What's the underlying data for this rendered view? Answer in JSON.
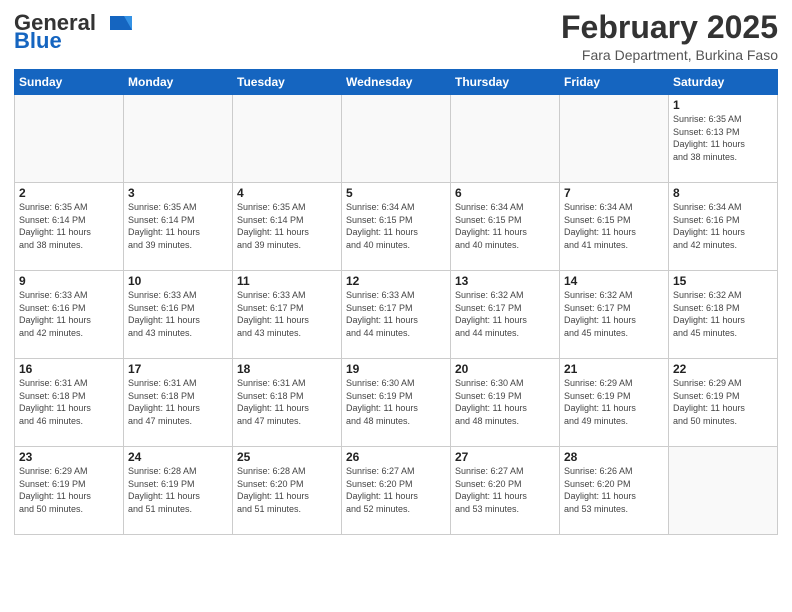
{
  "header": {
    "logo_general": "General",
    "logo_blue": "Blue",
    "month_year": "February 2025",
    "location": "Fara Department, Burkina Faso"
  },
  "days_of_week": [
    "Sunday",
    "Monday",
    "Tuesday",
    "Wednesday",
    "Thursday",
    "Friday",
    "Saturday"
  ],
  "weeks": [
    [
      {
        "day": "",
        "info": ""
      },
      {
        "day": "",
        "info": ""
      },
      {
        "day": "",
        "info": ""
      },
      {
        "day": "",
        "info": ""
      },
      {
        "day": "",
        "info": ""
      },
      {
        "day": "",
        "info": ""
      },
      {
        "day": "1",
        "info": "Sunrise: 6:35 AM\nSunset: 6:13 PM\nDaylight: 11 hours\nand 38 minutes."
      }
    ],
    [
      {
        "day": "2",
        "info": "Sunrise: 6:35 AM\nSunset: 6:14 PM\nDaylight: 11 hours\nand 38 minutes."
      },
      {
        "day": "3",
        "info": "Sunrise: 6:35 AM\nSunset: 6:14 PM\nDaylight: 11 hours\nand 39 minutes."
      },
      {
        "day": "4",
        "info": "Sunrise: 6:35 AM\nSunset: 6:14 PM\nDaylight: 11 hours\nand 39 minutes."
      },
      {
        "day": "5",
        "info": "Sunrise: 6:34 AM\nSunset: 6:15 PM\nDaylight: 11 hours\nand 40 minutes."
      },
      {
        "day": "6",
        "info": "Sunrise: 6:34 AM\nSunset: 6:15 PM\nDaylight: 11 hours\nand 40 minutes."
      },
      {
        "day": "7",
        "info": "Sunrise: 6:34 AM\nSunset: 6:15 PM\nDaylight: 11 hours\nand 41 minutes."
      },
      {
        "day": "8",
        "info": "Sunrise: 6:34 AM\nSunset: 6:16 PM\nDaylight: 11 hours\nand 42 minutes."
      }
    ],
    [
      {
        "day": "9",
        "info": "Sunrise: 6:33 AM\nSunset: 6:16 PM\nDaylight: 11 hours\nand 42 minutes."
      },
      {
        "day": "10",
        "info": "Sunrise: 6:33 AM\nSunset: 6:16 PM\nDaylight: 11 hours\nand 43 minutes."
      },
      {
        "day": "11",
        "info": "Sunrise: 6:33 AM\nSunset: 6:17 PM\nDaylight: 11 hours\nand 43 minutes."
      },
      {
        "day": "12",
        "info": "Sunrise: 6:33 AM\nSunset: 6:17 PM\nDaylight: 11 hours\nand 44 minutes."
      },
      {
        "day": "13",
        "info": "Sunrise: 6:32 AM\nSunset: 6:17 PM\nDaylight: 11 hours\nand 44 minutes."
      },
      {
        "day": "14",
        "info": "Sunrise: 6:32 AM\nSunset: 6:17 PM\nDaylight: 11 hours\nand 45 minutes."
      },
      {
        "day": "15",
        "info": "Sunrise: 6:32 AM\nSunset: 6:18 PM\nDaylight: 11 hours\nand 45 minutes."
      }
    ],
    [
      {
        "day": "16",
        "info": "Sunrise: 6:31 AM\nSunset: 6:18 PM\nDaylight: 11 hours\nand 46 minutes."
      },
      {
        "day": "17",
        "info": "Sunrise: 6:31 AM\nSunset: 6:18 PM\nDaylight: 11 hours\nand 47 minutes."
      },
      {
        "day": "18",
        "info": "Sunrise: 6:31 AM\nSunset: 6:18 PM\nDaylight: 11 hours\nand 47 minutes."
      },
      {
        "day": "19",
        "info": "Sunrise: 6:30 AM\nSunset: 6:19 PM\nDaylight: 11 hours\nand 48 minutes."
      },
      {
        "day": "20",
        "info": "Sunrise: 6:30 AM\nSunset: 6:19 PM\nDaylight: 11 hours\nand 48 minutes."
      },
      {
        "day": "21",
        "info": "Sunrise: 6:29 AM\nSunset: 6:19 PM\nDaylight: 11 hours\nand 49 minutes."
      },
      {
        "day": "22",
        "info": "Sunrise: 6:29 AM\nSunset: 6:19 PM\nDaylight: 11 hours\nand 50 minutes."
      }
    ],
    [
      {
        "day": "23",
        "info": "Sunrise: 6:29 AM\nSunset: 6:19 PM\nDaylight: 11 hours\nand 50 minutes."
      },
      {
        "day": "24",
        "info": "Sunrise: 6:28 AM\nSunset: 6:19 PM\nDaylight: 11 hours\nand 51 minutes."
      },
      {
        "day": "25",
        "info": "Sunrise: 6:28 AM\nSunset: 6:20 PM\nDaylight: 11 hours\nand 51 minutes."
      },
      {
        "day": "26",
        "info": "Sunrise: 6:27 AM\nSunset: 6:20 PM\nDaylight: 11 hours\nand 52 minutes."
      },
      {
        "day": "27",
        "info": "Sunrise: 6:27 AM\nSunset: 6:20 PM\nDaylight: 11 hours\nand 53 minutes."
      },
      {
        "day": "28",
        "info": "Sunrise: 6:26 AM\nSunset: 6:20 PM\nDaylight: 11 hours\nand 53 minutes."
      },
      {
        "day": "",
        "info": ""
      }
    ]
  ]
}
